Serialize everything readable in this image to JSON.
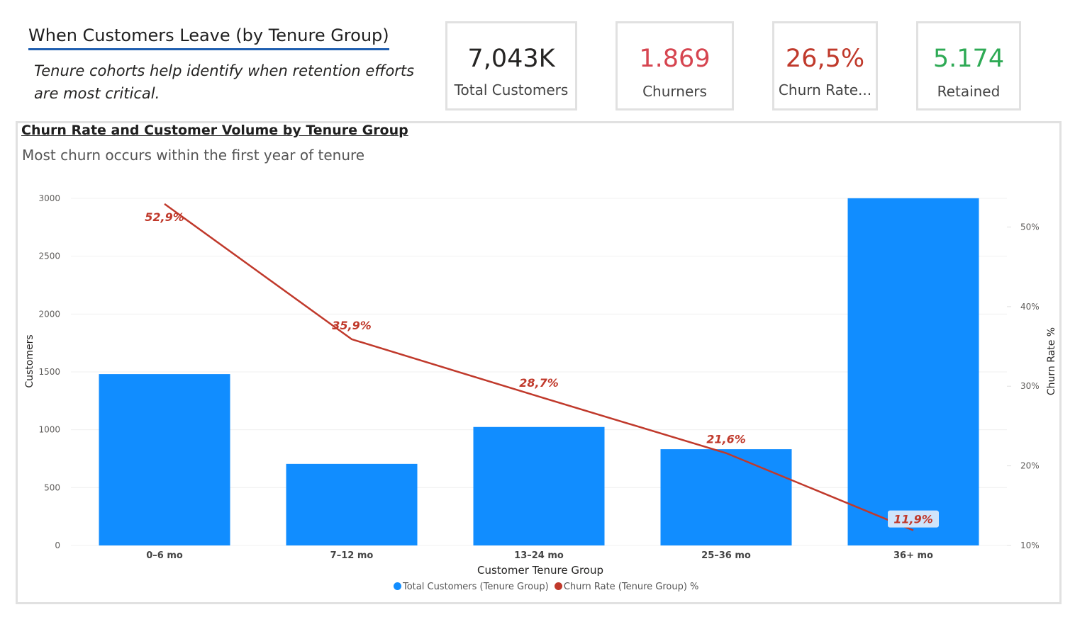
{
  "header": {
    "title": "When Customers Leave (by Tenure Group)",
    "subtitle": "Tenure cohorts help identify when retention efforts are most critical."
  },
  "kpis": [
    {
      "value": "7,043K",
      "label": "Total Customers",
      "color": "#252423"
    },
    {
      "value": "1.869",
      "label": "Churners",
      "color": "#d64550"
    },
    {
      "value": "26,5%",
      "label": "Churn Rate...",
      "color": "#c0392b"
    },
    {
      "value": "5.174",
      "label": "Retained",
      "color": "#2eaa55"
    }
  ],
  "chart": {
    "title": "Churn Rate and Customer Volume by Tenure Group",
    "subtitle": "Most churn occurs within the first year of tenure",
    "legend": [
      {
        "label": "Total Customers (Tenure Group)",
        "color": "#118dff"
      },
      {
        "label": "Churn Rate (Tenure Group) %",
        "color": "#c0392b"
      }
    ]
  },
  "chart_data": {
    "type": "bar",
    "title": "Churn Rate and Customer Volume by Tenure Group",
    "xlabel": "Customer Tenure Group",
    "ylabel": "Customers",
    "y2label": "Churn Rate %",
    "categories": [
      "0–6 mo",
      "7–12 mo",
      "13–24 mo",
      "25–36 mo",
      "36+ mo"
    ],
    "series": [
      {
        "name": "Total Customers (Tenure Group)",
        "type": "bar",
        "axis": "left",
        "color": "#118dff",
        "values": [
          1481,
          705,
          1024,
          832,
          3001
        ]
      },
      {
        "name": "Churn Rate (Tenure Group) %",
        "type": "line",
        "axis": "right",
        "color": "#c0392b",
        "values": [
          52.9,
          35.9,
          28.7,
          21.6,
          11.9
        ],
        "labels": [
          "52,9%",
          "35,9%",
          "28,7%",
          "21,6%",
          "11,9%"
        ]
      }
    ],
    "ylim": [
      0,
      3000
    ],
    "yticks": [
      0,
      500,
      1000,
      1500,
      2000,
      2500,
      3000
    ],
    "y2lim": [
      10,
      53.6
    ],
    "y2ticks": [
      10,
      20,
      30,
      40,
      50
    ],
    "y2ticklabels": [
      "10%",
      "20%",
      "30%",
      "40%",
      "50%"
    ],
    "grid": true,
    "legend_position": "bottom"
  }
}
